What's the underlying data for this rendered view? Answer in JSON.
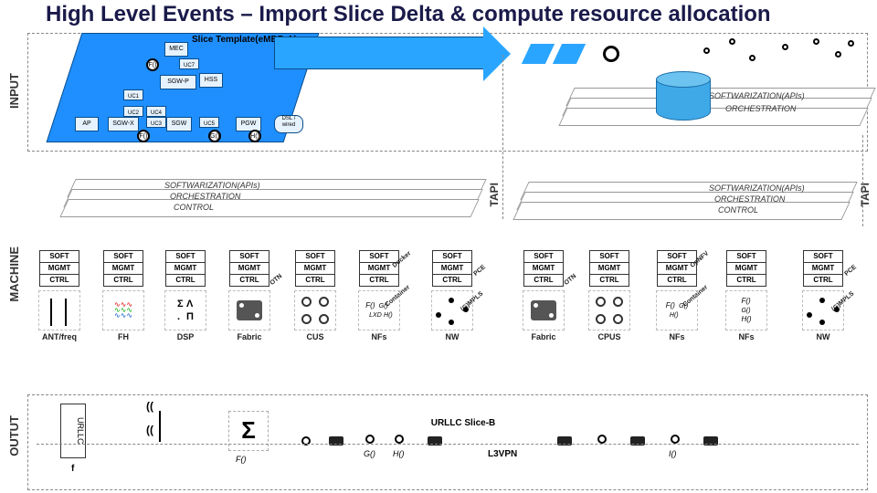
{
  "title": "High Level Events – Import Slice Delta & compute resource allocation",
  "vlabels": {
    "input": "INPUT",
    "machine": "MACHINE",
    "output": "OUTUT",
    "tapi": "TAPI"
  },
  "slice_template": {
    "label": "Slice Template(eMBB-A)"
  },
  "template_nodes": {
    "mec": "MEC",
    "sgw_p": "SGW-P",
    "hss": "HSS",
    "ap": "AP",
    "sgw_x": "SGW-X",
    "sgw": "SGW",
    "pgw": "PGW",
    "uc1": "UC1",
    "uc2": "UC2",
    "uc3": "UC3",
    "uc4": "UC4",
    "uc5": "UC5",
    "uc7": "UC7",
    "dsl_wired": "DSL / wired"
  },
  "template_funcs": {
    "f0": "F()",
    "f1": "F()",
    "g0": "G()",
    "h0": "H()"
  },
  "soft_stack": {
    "soft": "SOFTWARIZATION(APIs)",
    "orch": "ORCHESTRATION",
    "ctrl": "CONTROL"
  },
  "res_cell": {
    "soft": "SOFT",
    "mgmt": "MGMT",
    "ctrl": "CTRL"
  },
  "side": {
    "otn": "OTN",
    "docker": "Docker",
    "container": "Container",
    "pce": "PCE",
    "gmpls": "(G)MPLS",
    "opnfv": "OpNFV",
    "lxd": "LXD"
  },
  "res_labels": {
    "ant": "ANT/freq",
    "fh": "FH",
    "dsp": "DSP",
    "fabric": "Fabric",
    "cus": "CUS",
    "nfs": "NFs",
    "nw": "NW",
    "cpus": "CPUS"
  },
  "nf_funcs": {
    "f0": "F()",
    "g0": "G()",
    "h0": "H()"
  },
  "output": {
    "urllc": "URLLC",
    "f": "f",
    "sigma": "Σ",
    "f0": "F()",
    "g0": "G()",
    "h0": "H()",
    "i0": "I()",
    "urllc_b": "URLLC Slice-B",
    "l3vpn": "L3VPN",
    "wave1": "((",
    "wave2": "(("
  }
}
